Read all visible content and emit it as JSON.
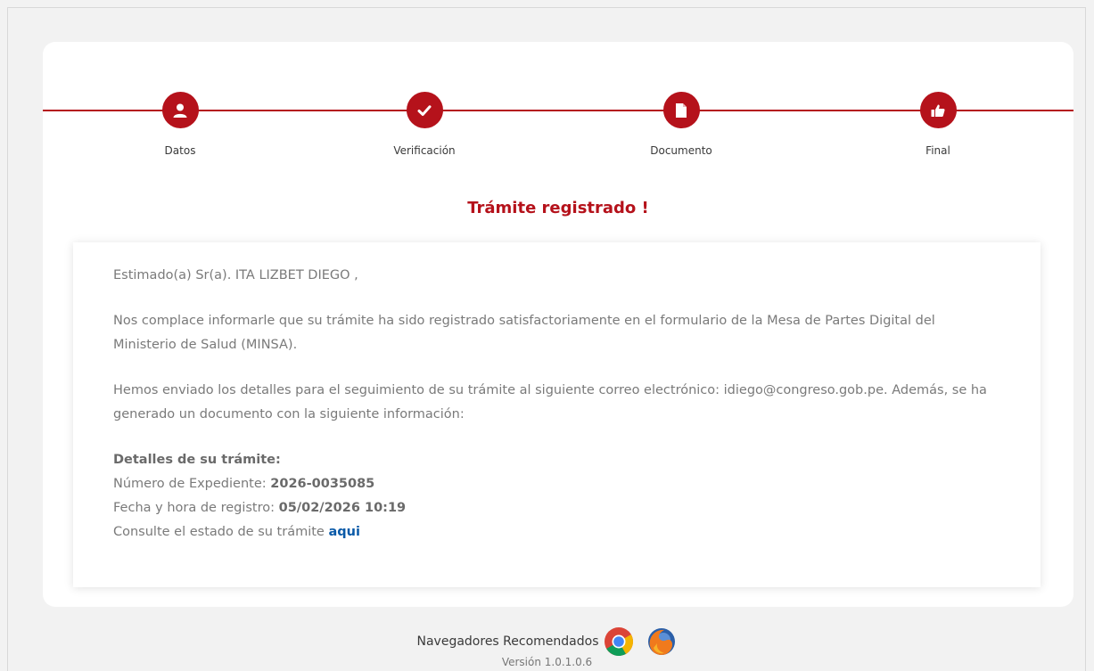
{
  "colors": {
    "brand": "#b5121b",
    "link": "#0a5aa8"
  },
  "steps": [
    {
      "label": "Datos",
      "icon": "user-icon"
    },
    {
      "label": "Verificación",
      "icon": "check-icon"
    },
    {
      "label": "Documento",
      "icon": "document-icon"
    },
    {
      "label": "Final",
      "icon": "thumbs-up-icon"
    }
  ],
  "title": "Trámite registrado !",
  "message": {
    "greeting": "Estimado(a) Sr(a). ITA LIZBET DIEGO ,",
    "paragraph1": "Nos complace informarle que su trámite ha sido registrado satisfactoriamente en el formulario de la Mesa de Partes Digital del Ministerio de Salud (MINSA).",
    "paragraph2": "Hemos enviado los detalles para el seguimiento de su trámite al siguiente correo electrónico: idiego@congreso.gob.pe. Además, se ha generado un documento con la siguiente información:",
    "details_heading": "Detalles de su trámite:",
    "expediente_label": "Número de Expediente: ",
    "expediente_value": "2026-0035085",
    "fecha_label": "Fecha y hora de registro: ",
    "fecha_value": "05/02/2026 10:19",
    "consulte_text": "Consulte el estado de su trámite ",
    "consulte_link": "aqui"
  },
  "footer": {
    "browsers_label": "Navegadores Recomendados",
    "browsers": [
      "chrome-icon",
      "firefox-icon"
    ],
    "version_text": "Versión 1.0.1.0.6"
  }
}
